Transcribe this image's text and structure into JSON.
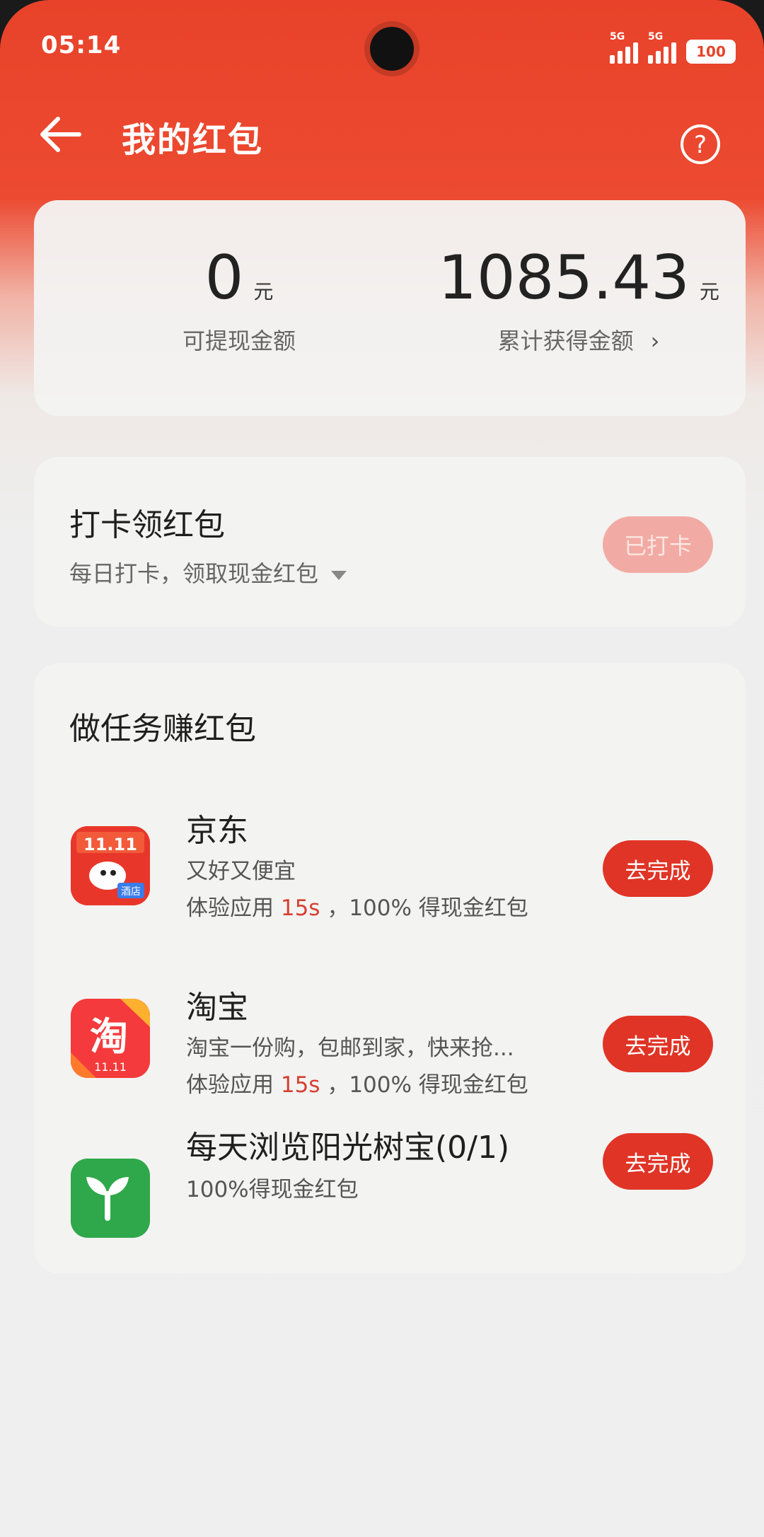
{
  "status_bar": {
    "time": "05:14",
    "signal1_tag": "5G",
    "signal2_tag": "5G",
    "battery": "100"
  },
  "header": {
    "title": "我的红包",
    "back_icon": "back-arrow-icon",
    "help_icon": "help-icon"
  },
  "balance": {
    "withdrawable_value": "0",
    "withdrawable_unit": "元",
    "withdrawable_label": "可提现金额",
    "total_value": "1085.43",
    "total_unit": "元",
    "total_label": "累计获得金额",
    "total_chevron": "›"
  },
  "checkin": {
    "title": "打卡领红包",
    "subtitle": "每日打卡，领取现金红包",
    "button": "已打卡"
  },
  "tasks": {
    "heading": "做任务赚红包",
    "items": [
      {
        "name": "京东",
        "desc1": "又好又便宜",
        "desc2_prefix": "体验应用 ",
        "desc2_highlight": "15s",
        "desc2_suffix": " ，100% 得现金红包",
        "button": "去完成",
        "icon": "jd-app-icon",
        "icon_text": "11.11",
        "icon_badge": "酒店"
      },
      {
        "name": "淘宝",
        "desc1": "淘宝一份购，包邮到家，快来抢...",
        "desc2_prefix": "体验应用 ",
        "desc2_highlight": "15s",
        "desc2_suffix": " ，100% 得现金红包",
        "button": "去完成",
        "icon": "taobao-app-icon",
        "icon_text": "淘",
        "icon_badge": "11.11"
      },
      {
        "name": "每天浏览阳光树宝(0/1)",
        "desc1": "100%得现金红包",
        "button": "去完成",
        "icon": "sprout-app-icon"
      }
    ]
  },
  "colors": {
    "brand": "#e8432a",
    "button": "#e03426",
    "button_disabled": "#f2aba4"
  }
}
